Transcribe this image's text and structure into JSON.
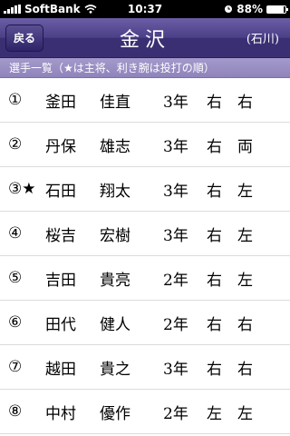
{
  "status_bar": {
    "carrier": "SoftBank",
    "time": "10:37",
    "battery": "88%",
    "battery_level": 0.88,
    "icons": [
      "signal-icon",
      "wifi-icon",
      "alarm-icon",
      "battery-icon"
    ]
  },
  "nav": {
    "back_label": "戻る",
    "title": "金沢",
    "subtitle": "(石川)"
  },
  "section": {
    "header": "選手一覧（★は主将、利き腕は投打の順）"
  },
  "players": [
    {
      "num": "①",
      "last": "釜田",
      "first": "佳直",
      "grade": "3年",
      "throw": "右",
      "bat": "右"
    },
    {
      "num": "②",
      "last": "丹保",
      "first": "雄志",
      "grade": "3年",
      "throw": "右",
      "bat": "両"
    },
    {
      "num": "③★",
      "last": "石田",
      "first": "翔太",
      "grade": "3年",
      "throw": "右",
      "bat": "左"
    },
    {
      "num": "④",
      "last": "桜吉",
      "first": "宏樹",
      "grade": "3年",
      "throw": "右",
      "bat": "左"
    },
    {
      "num": "⑤",
      "last": "吉田",
      "first": "貴亮",
      "grade": "2年",
      "throw": "右",
      "bat": "左"
    },
    {
      "num": "⑥",
      "last": "田代",
      "first": "健人",
      "grade": "2年",
      "throw": "右",
      "bat": "右"
    },
    {
      "num": "⑦",
      "last": "越田",
      "first": "貴之",
      "grade": "3年",
      "throw": "右",
      "bat": "右"
    },
    {
      "num": "⑧",
      "last": "中村",
      "first": "優作",
      "grade": "2年",
      "throw": "左",
      "bat": "左"
    }
  ],
  "colors": {
    "nav_bar": "#3a2f73",
    "section_header": "#9a8fc4"
  }
}
